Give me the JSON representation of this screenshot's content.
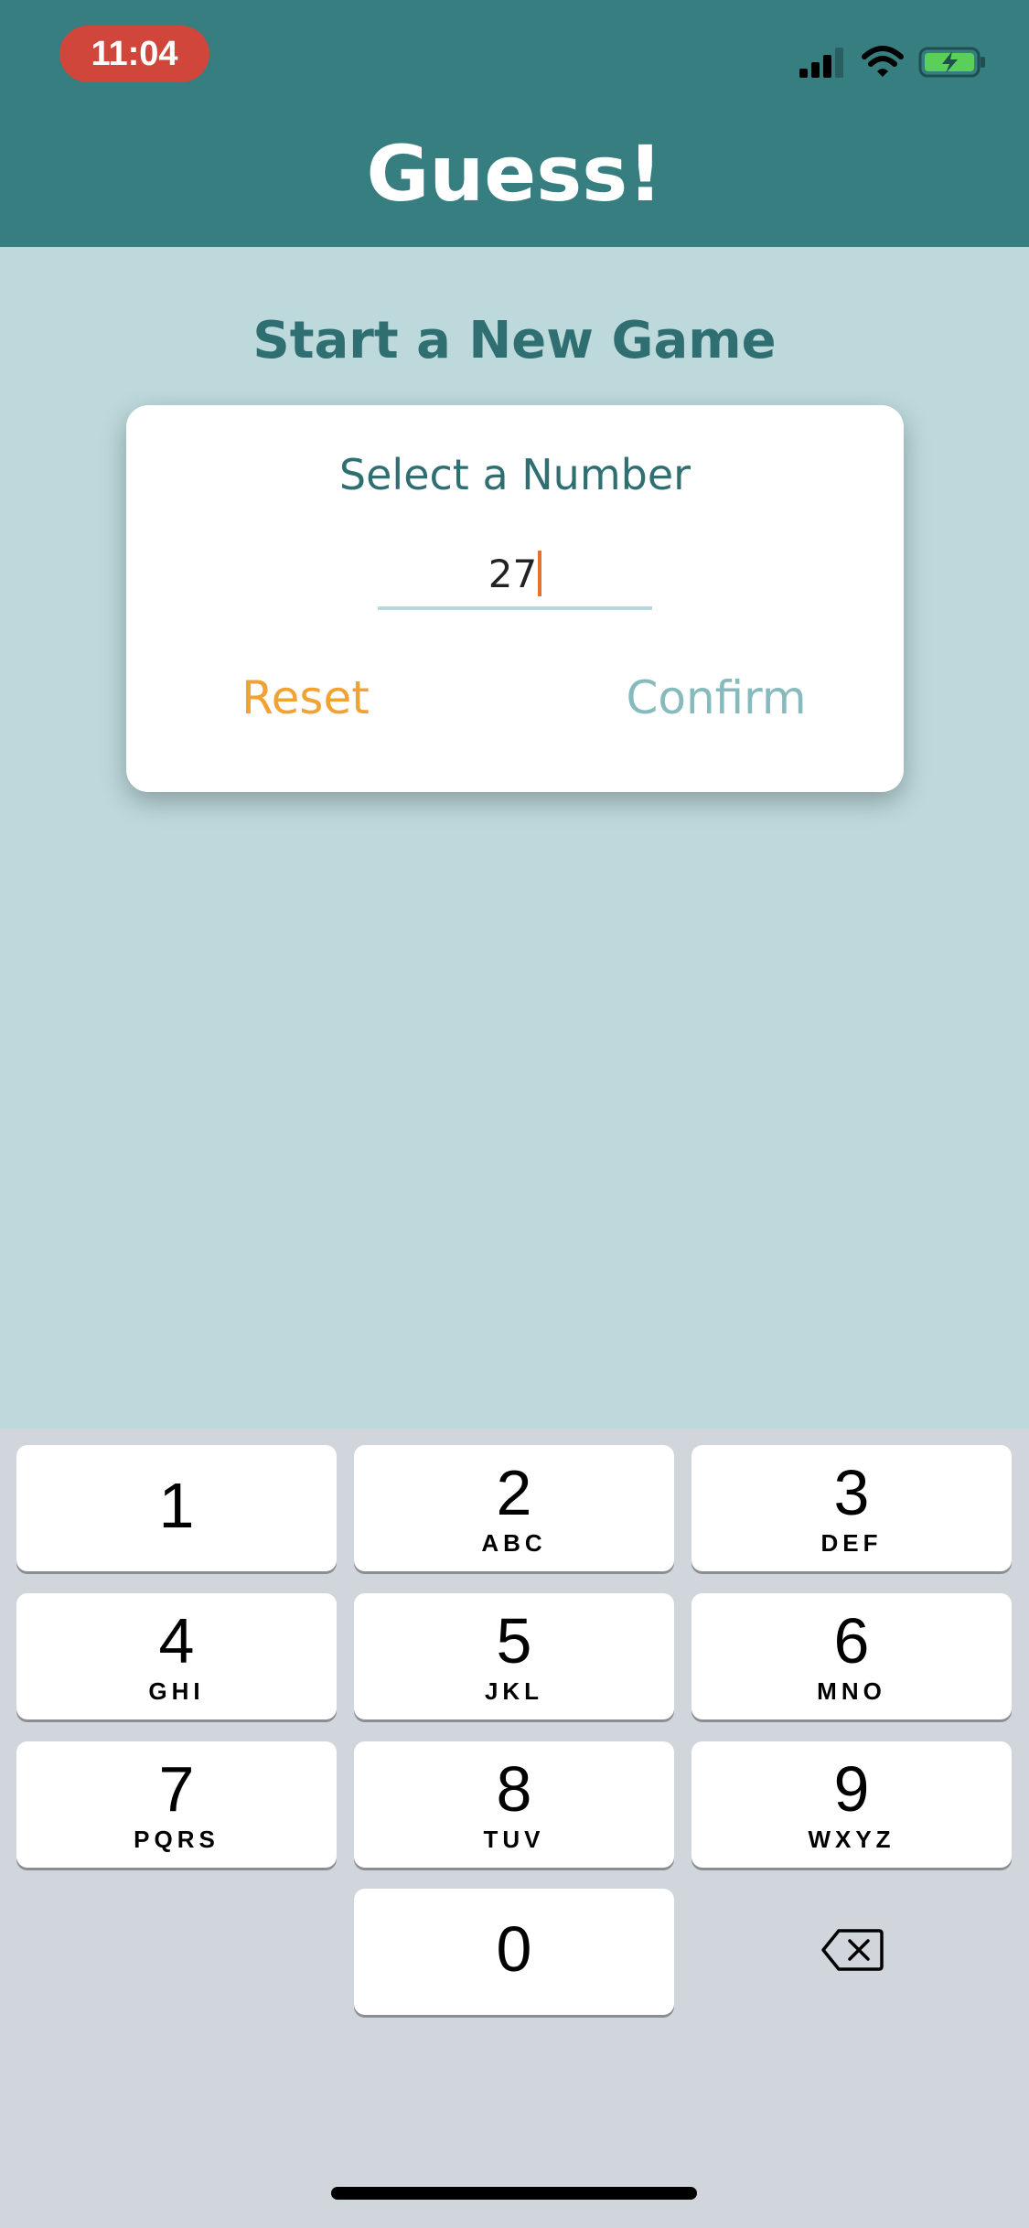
{
  "status_bar": {
    "time": "11:04",
    "icons": [
      "signal-icon",
      "wifi-icon",
      "battery-charging-icon"
    ]
  },
  "header": {
    "title": "Guess!"
  },
  "main": {
    "subtitle": "Start a New Game",
    "card": {
      "label": "Select a Number",
      "input_value": "27",
      "reset_label": "Reset",
      "confirm_label": "Confirm"
    }
  },
  "keyboard": {
    "keys": [
      {
        "digit": "1",
        "letters": ""
      },
      {
        "digit": "2",
        "letters": "ABC"
      },
      {
        "digit": "3",
        "letters": "DEF"
      },
      {
        "digit": "4",
        "letters": "GHI"
      },
      {
        "digit": "5",
        "letters": "JKL"
      },
      {
        "digit": "6",
        "letters": "MNO"
      },
      {
        "digit": "7",
        "letters": "PQRS"
      },
      {
        "digit": "8",
        "letters": "TUV"
      },
      {
        "digit": "9",
        "letters": "WXYZ"
      },
      {
        "digit": "0",
        "letters": ""
      }
    ],
    "backspace_icon": "backspace-icon"
  },
  "colors": {
    "header": "#377e80",
    "background": "#bdd9dc",
    "accent_reset": "#f0a233",
    "accent_confirm": "#86babd",
    "time_pill": "#d0463b",
    "caret": "#e8702a"
  }
}
